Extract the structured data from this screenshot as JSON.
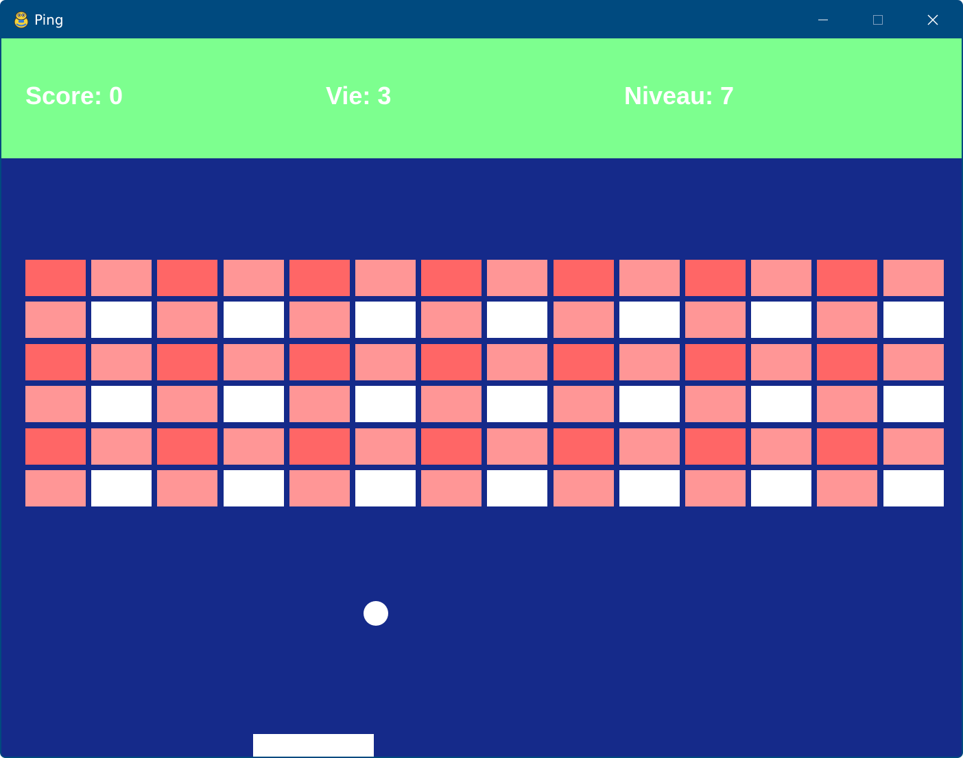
{
  "window": {
    "title": "Ping",
    "app_icon": "python-snake-icon",
    "controls": {
      "minimize_icon": "minimize-icon",
      "maximize_icon": "maximize-icon",
      "close_icon": "close-icon"
    }
  },
  "hud": {
    "score_text": "Score: 0",
    "lives_text": "Vie: 3",
    "level_text": "Niveau: 7"
  },
  "colors": {
    "titlebar": "#004a7f",
    "hud_background": "#7dff8f",
    "playfield": "#152a8a",
    "brick_strong": "#ff6666",
    "brick_light": "#ff9696",
    "brick_white": "#ffffff",
    "ball": "#ffffff",
    "paddle": "#ffffff"
  },
  "bricks": {
    "columns": 14,
    "rows": [
      [
        "strong",
        "light",
        "strong",
        "light",
        "strong",
        "light",
        "strong",
        "light",
        "strong",
        "light",
        "strong",
        "light",
        "strong",
        "light"
      ],
      [
        "light",
        "white",
        "light",
        "white",
        "light",
        "white",
        "light",
        "white",
        "light",
        "white",
        "light",
        "white",
        "light",
        "white"
      ],
      [
        "strong",
        "light",
        "strong",
        "light",
        "strong",
        "light",
        "strong",
        "light",
        "strong",
        "light",
        "strong",
        "light",
        "strong",
        "light"
      ],
      [
        "light",
        "white",
        "light",
        "white",
        "light",
        "white",
        "light",
        "white",
        "light",
        "white",
        "light",
        "white",
        "light",
        "white"
      ],
      [
        "strong",
        "light",
        "strong",
        "light",
        "strong",
        "light",
        "strong",
        "light",
        "strong",
        "light",
        "strong",
        "light",
        "strong",
        "light"
      ],
      [
        "light",
        "white",
        "light",
        "white",
        "light",
        "white",
        "light",
        "white",
        "light",
        "white",
        "light",
        "white",
        "light",
        "white"
      ]
    ]
  }
}
